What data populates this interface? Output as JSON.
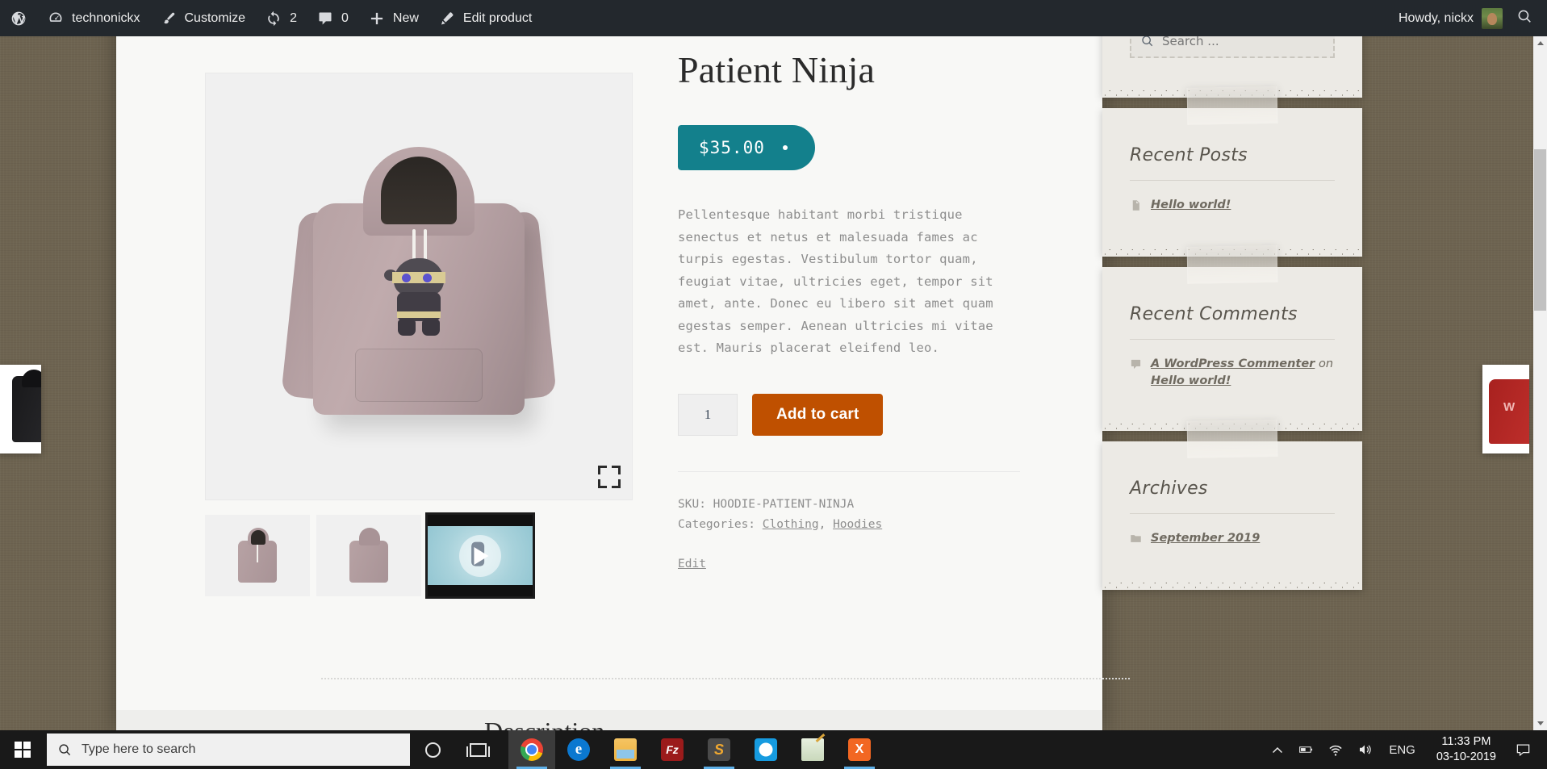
{
  "adminbar": {
    "site_name": "technonickx",
    "customize": "Customize",
    "updates_count": "2",
    "comments_count": "0",
    "new": "New",
    "edit_product": "Edit product",
    "howdy": "Howdy, nickx"
  },
  "product": {
    "title": "Patient Ninja",
    "price": "$35.00",
    "short_description": "Pellentesque habitant morbi tristique senectus et netus et malesuada fames ac turpis egestas. Vestibulum tortor quam, feugiat vitae, ultricies eget, tempor sit amet, ante. Donec eu libero sit amet quam egestas semper. Aenean ultricies mi vitae est. Mauris placerat eleifend leo.",
    "quantity": "1",
    "add_to_cart": "Add to cart",
    "sku_label": "SKU:",
    "sku_value": "HOODIE-PATIENT-NINJA",
    "categories_label": "Categories:",
    "category_1": "Clothing",
    "category_sep": ",",
    "category_2": "Hoodies",
    "edit": "Edit",
    "description_heading": "Description",
    "accent_price_bg": "#13808c",
    "accent_cart_bg": "#bf5000"
  },
  "sidebar": {
    "search_placeholder": "Search ...",
    "widgets": [
      {
        "title": "Recent Posts",
        "items": [
          {
            "icon": "document-icon",
            "link": "Hello world!"
          }
        ]
      },
      {
        "title": "Recent Comments",
        "items": [
          {
            "icon": "comment-icon",
            "author": "A WordPress Commenter",
            "on": "on",
            "post": "Hello world!"
          }
        ]
      },
      {
        "title": "Archives",
        "items": [
          {
            "icon": "folder-icon",
            "link": "September 2019"
          }
        ]
      }
    ]
  },
  "taskbar": {
    "search_placeholder": "Type here to search",
    "apps": [
      {
        "name": "google-chrome",
        "label": "Chrome"
      },
      {
        "name": "microsoft-edge",
        "label": "Edge"
      },
      {
        "name": "file-explorer",
        "label": "File Explorer"
      },
      {
        "name": "filezilla",
        "label": "Fz"
      },
      {
        "name": "sublime-text",
        "label": "S"
      },
      {
        "name": "whatsapp",
        "label": "WhatsApp"
      },
      {
        "name": "paint",
        "label": "Paint"
      },
      {
        "name": "xampp",
        "label": "X"
      }
    ],
    "language": "ENG",
    "time": "11:33 PM",
    "date": "03-10-2019"
  }
}
